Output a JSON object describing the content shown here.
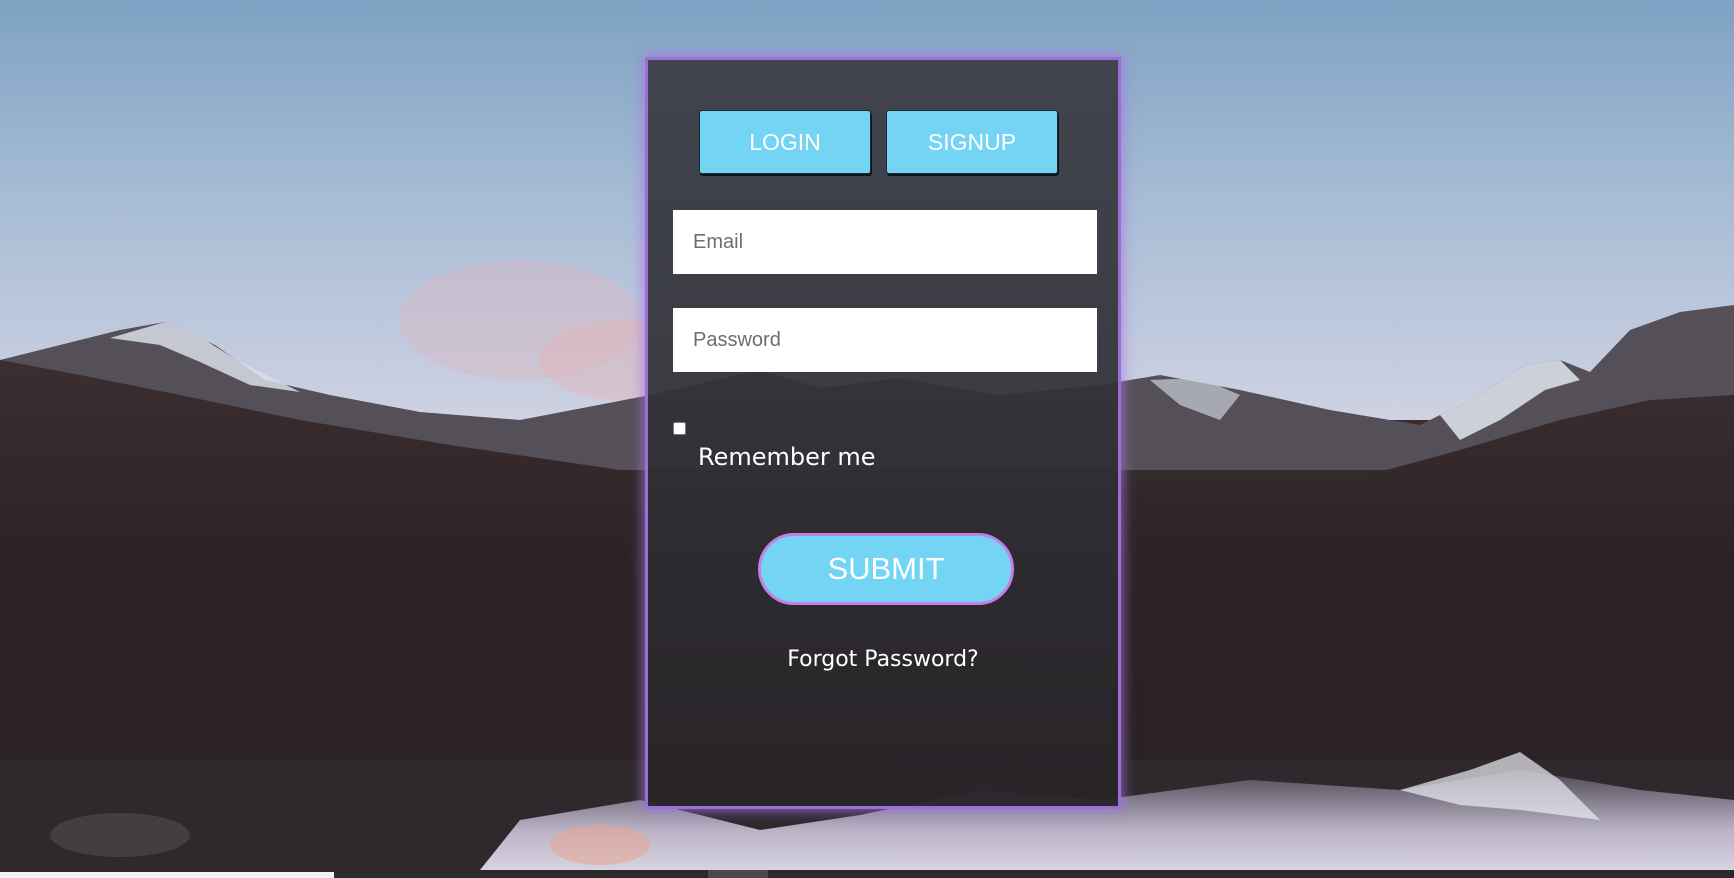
{
  "tabs": {
    "login_label": "LOGIN",
    "signup_label": "SIGNUP"
  },
  "form": {
    "email_placeholder": "Email",
    "password_placeholder": "Password",
    "remember_label": "Remember me",
    "remember_checked": false,
    "submit_label": "SUBMIT",
    "forgot_label": "Forgot Password?"
  },
  "colors": {
    "button_fill": "#74d4f4",
    "panel_glow": "#9b6fd4",
    "submit_border": "#c27fe6"
  }
}
